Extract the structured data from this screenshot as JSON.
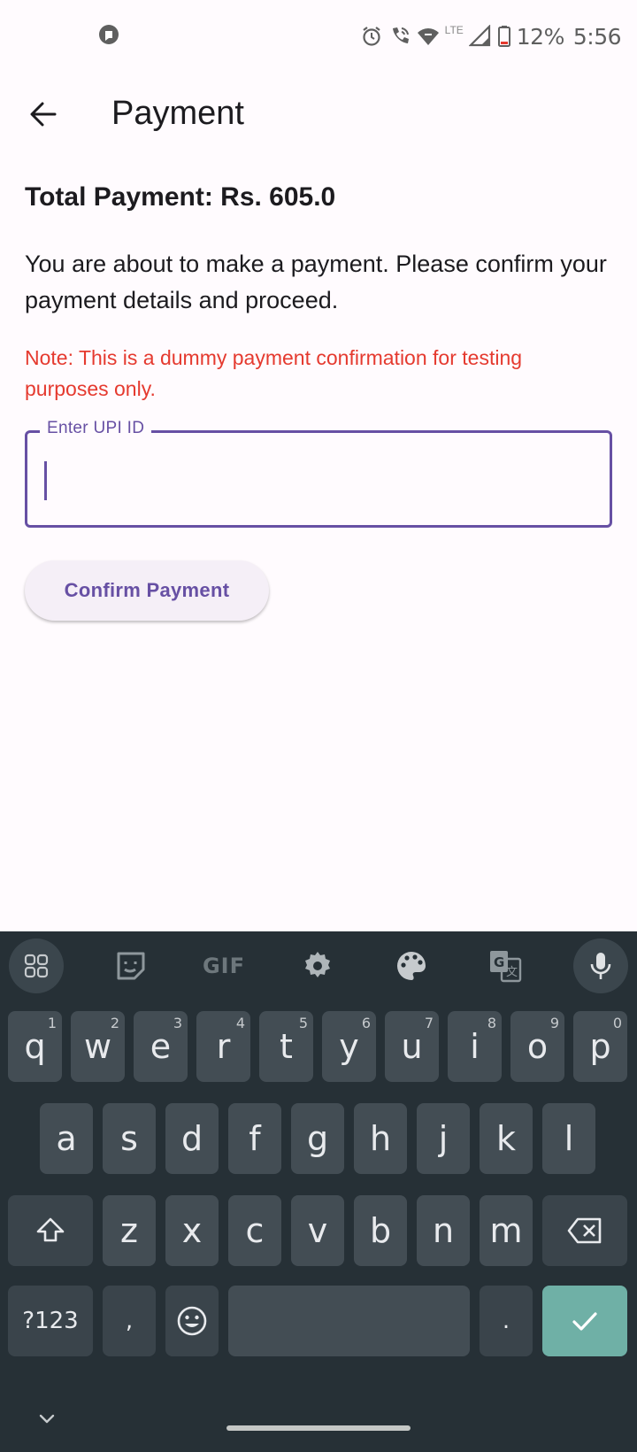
{
  "status_bar": {
    "left_icon": "app-notification-icon",
    "icons": [
      "alarm-icon",
      "wifi-calling-icon",
      "wifi-icon",
      "lte-icon",
      "signal-icon",
      "battery-low-icon"
    ],
    "lte": "LTE",
    "battery": "12%",
    "time": "5:56"
  },
  "app_bar": {
    "back_icon": "arrow-back-icon",
    "title": "Payment"
  },
  "content": {
    "total": "Total Payment: Rs. 605.0",
    "description": "You are about to make a payment. Please confirm your payment details and proceed.",
    "note": "Note: This is a dummy payment confirmation for testing purposes only.",
    "upi_field": {
      "label": "Enter UPI ID",
      "value": ""
    },
    "confirm_label": "Confirm Payment"
  },
  "colors": {
    "primary": "#6750a4",
    "note": "#e53a2f",
    "background": "#fffbfe",
    "keyboard_bg": "#263036",
    "key_bg": "#434d54",
    "enter_key": "#6fb0a6"
  },
  "keyboard": {
    "toolbar": [
      "apps-grid-icon",
      "sticker-icon",
      "gif-icon",
      "settings-gear-icon",
      "palette-icon",
      "translate-icon",
      "microphone-icon"
    ],
    "gif_label": "GIF",
    "row1": [
      {
        "k": "q",
        "h": "1"
      },
      {
        "k": "w",
        "h": "2"
      },
      {
        "k": "e",
        "h": "3"
      },
      {
        "k": "r",
        "h": "4"
      },
      {
        "k": "t",
        "h": "5"
      },
      {
        "k": "y",
        "h": "6"
      },
      {
        "k": "u",
        "h": "7"
      },
      {
        "k": "i",
        "h": "8"
      },
      {
        "k": "o",
        "h": "9"
      },
      {
        "k": "p",
        "h": "0"
      }
    ],
    "row2": [
      "a",
      "s",
      "d",
      "f",
      "g",
      "h",
      "j",
      "k",
      "l"
    ],
    "row3": [
      "z",
      "x",
      "c",
      "v",
      "b",
      "n",
      "m"
    ],
    "symbols": "?123",
    "comma": ",",
    "period": ".",
    "hide_icon": "chevron-down-icon"
  }
}
